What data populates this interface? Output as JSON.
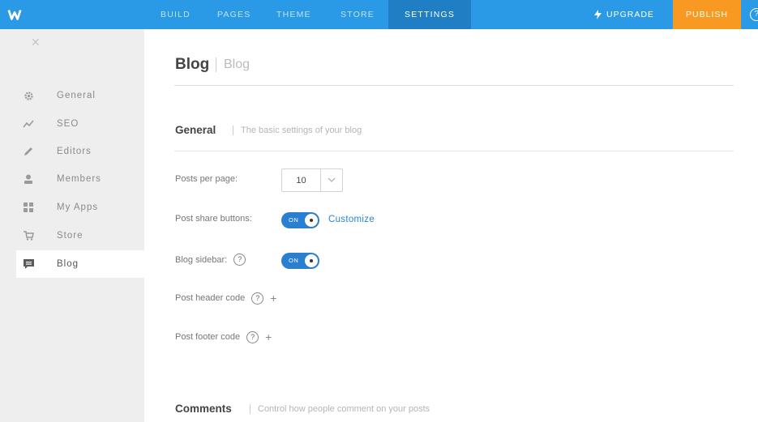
{
  "topbar": {
    "nav": [
      "BUILD",
      "PAGES",
      "THEME",
      "STORE",
      "SETTINGS"
    ],
    "active_nav": "SETTINGS",
    "upgrade_label": "UPGRADE",
    "publish_label": "PUBLISH",
    "help_symbol": "?",
    "colors": {
      "bar": "#2a9ae6",
      "active": "#1f7ec4",
      "publish": "#f89a22"
    }
  },
  "sidebar": {
    "close_symbol": "✕",
    "items": [
      {
        "label": "General",
        "icon": "gear-icon"
      },
      {
        "label": "SEO",
        "icon": "trend-icon"
      },
      {
        "label": "Editors",
        "icon": "pencil-icon"
      },
      {
        "label": "Members",
        "icon": "person-icon"
      },
      {
        "label": "My Apps",
        "icon": "apps-grid-icon"
      },
      {
        "label": "Store",
        "icon": "cart-icon"
      },
      {
        "label": "Blog",
        "icon": "chat-icon"
      }
    ],
    "active_item": "Blog"
  },
  "main": {
    "title": "Blog",
    "subtitle": "Blog",
    "general": {
      "title": "General",
      "desc": "The basic settings of your blog",
      "posts_per_page_label": "Posts per page:",
      "posts_per_page_value": "10",
      "share_label": "Post share buttons:",
      "share_toggle": "ON",
      "customize_label": "Customize",
      "sidebar_label": "Blog sidebar:",
      "sidebar_toggle": "ON",
      "header_code_label": "Post header code",
      "footer_code_label": "Post footer code",
      "help_symbol": "?",
      "plus_symbol": "+"
    },
    "comments": {
      "title": "Comments",
      "desc": "Control how people comment on your posts"
    }
  }
}
